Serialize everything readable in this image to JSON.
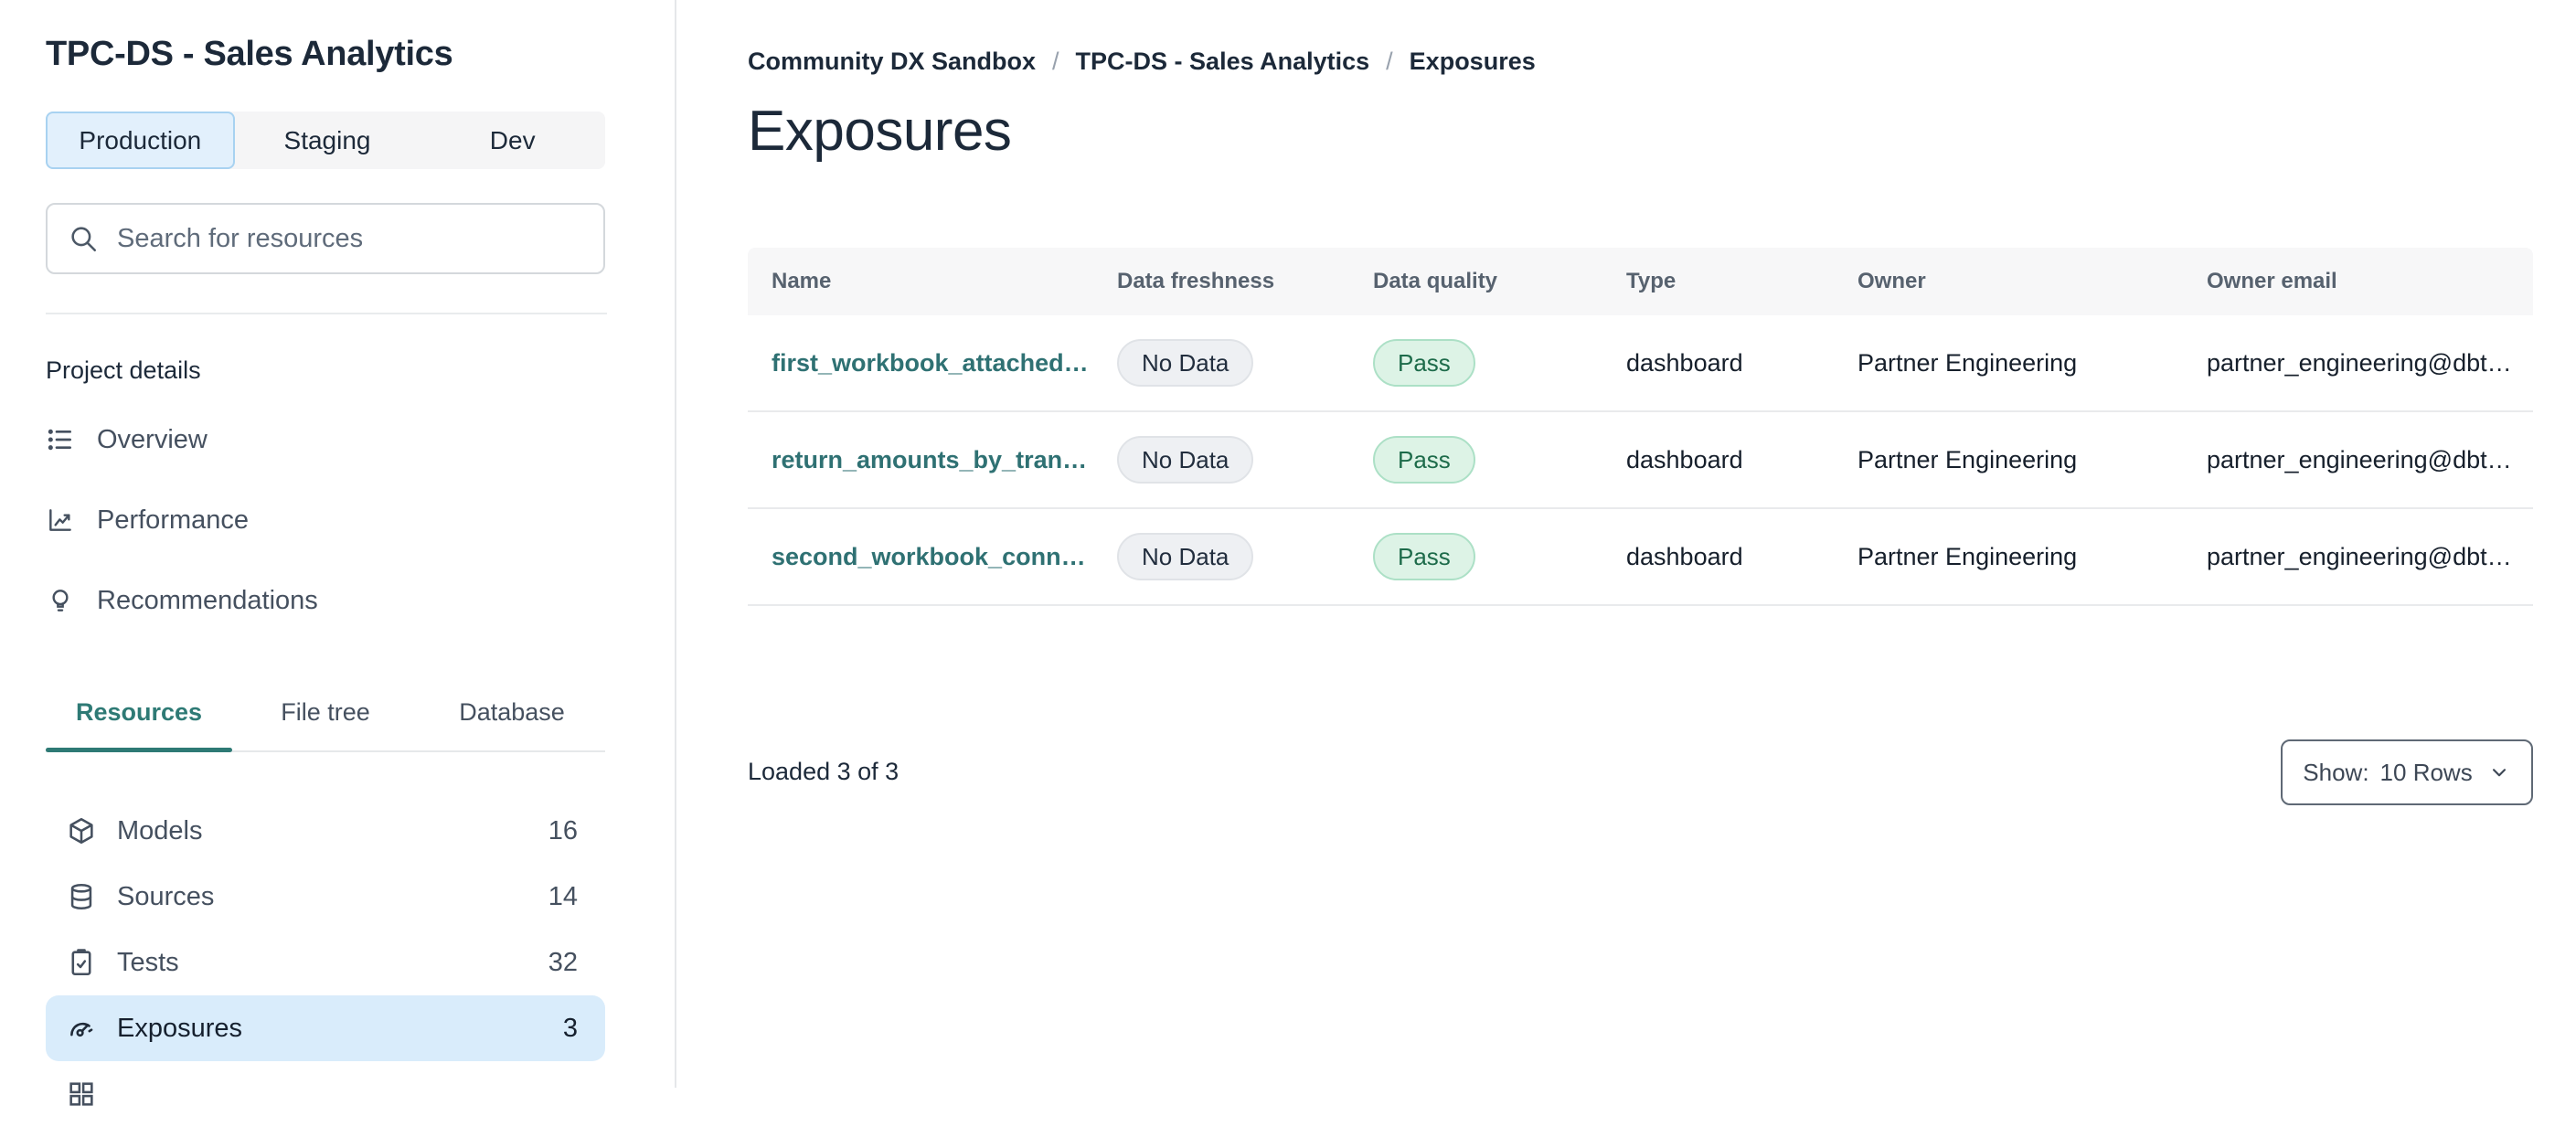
{
  "colors": {
    "accent_teal": "#2e7a75",
    "link_teal": "#2f7173",
    "active_env_tab_bg": "#e2f0fc",
    "active_env_tab_border": "#a8d2f1",
    "active_resource_row_bg": "#d9ecfb",
    "pass_badge_bg": "#ddf3e6",
    "pass_badge_text": "#1d6b4a",
    "nodata_badge_bg": "#eef0f3",
    "nodata_badge_text": "#222e3e",
    "dark_text": "#1c2939"
  },
  "sidebar": {
    "project_title": "TPC-DS - Sales Analytics",
    "env_tabs": [
      {
        "label": "Production",
        "active": true
      },
      {
        "label": "Staging",
        "active": false
      },
      {
        "label": "Dev",
        "active": false
      }
    ],
    "search_placeholder": "Search for resources",
    "section_label": "Project details",
    "nav_items": [
      {
        "label": "Overview",
        "icon": "list-icon"
      },
      {
        "label": "Performance",
        "icon": "chart-line-icon"
      },
      {
        "label": "Recommendations",
        "icon": "lightbulb-icon"
      }
    ],
    "resource_tabs": [
      {
        "label": "Resources",
        "active": true
      },
      {
        "label": "File tree",
        "active": false
      },
      {
        "label": "Database",
        "active": false
      }
    ],
    "resource_items": [
      {
        "label": "Models",
        "count": "16",
        "icon": "cube-icon",
        "active": false
      },
      {
        "label": "Sources",
        "count": "14",
        "icon": "database-icon",
        "active": false
      },
      {
        "label": "Tests",
        "count": "32",
        "icon": "clipboard-check-icon",
        "active": false
      },
      {
        "label": "Exposures",
        "count": "3",
        "icon": "gauge-icon",
        "active": true
      }
    ]
  },
  "main": {
    "breadcrumb": {
      "items": [
        "Community DX Sandbox",
        "TPC-DS - Sales Analytics",
        "Exposures"
      ],
      "separator": "/"
    },
    "page_title": "Exposures",
    "table": {
      "columns": [
        "Name",
        "Data freshness",
        "Data quality",
        "Type",
        "Owner",
        "Owner email"
      ],
      "rows": [
        {
          "name": "first_workbook_attached",
          "ellipsis": "…",
          "freshness": "No Data",
          "quality": "Pass",
          "type": "dashboard",
          "owner": "Partner Engineering",
          "owner_email": "partner_engineering@dbt…"
        },
        {
          "name": "return_amounts_by_tran",
          "ellipsis": "…",
          "freshness": "No Data",
          "quality": "Pass",
          "type": "dashboard",
          "owner": "Partner Engineering",
          "owner_email": "partner_engineering@dbt…"
        },
        {
          "name": "second_workbook_conn",
          "ellipsis": "…",
          "freshness": "No Data",
          "quality": "Pass",
          "type": "dashboard",
          "owner": "Partner Engineering",
          "owner_email": "partner_engineering@dbt…"
        }
      ]
    },
    "footer": {
      "loaded_text": "Loaded 3 of 3",
      "show_label": "Show:",
      "show_value": "10 Rows"
    }
  }
}
